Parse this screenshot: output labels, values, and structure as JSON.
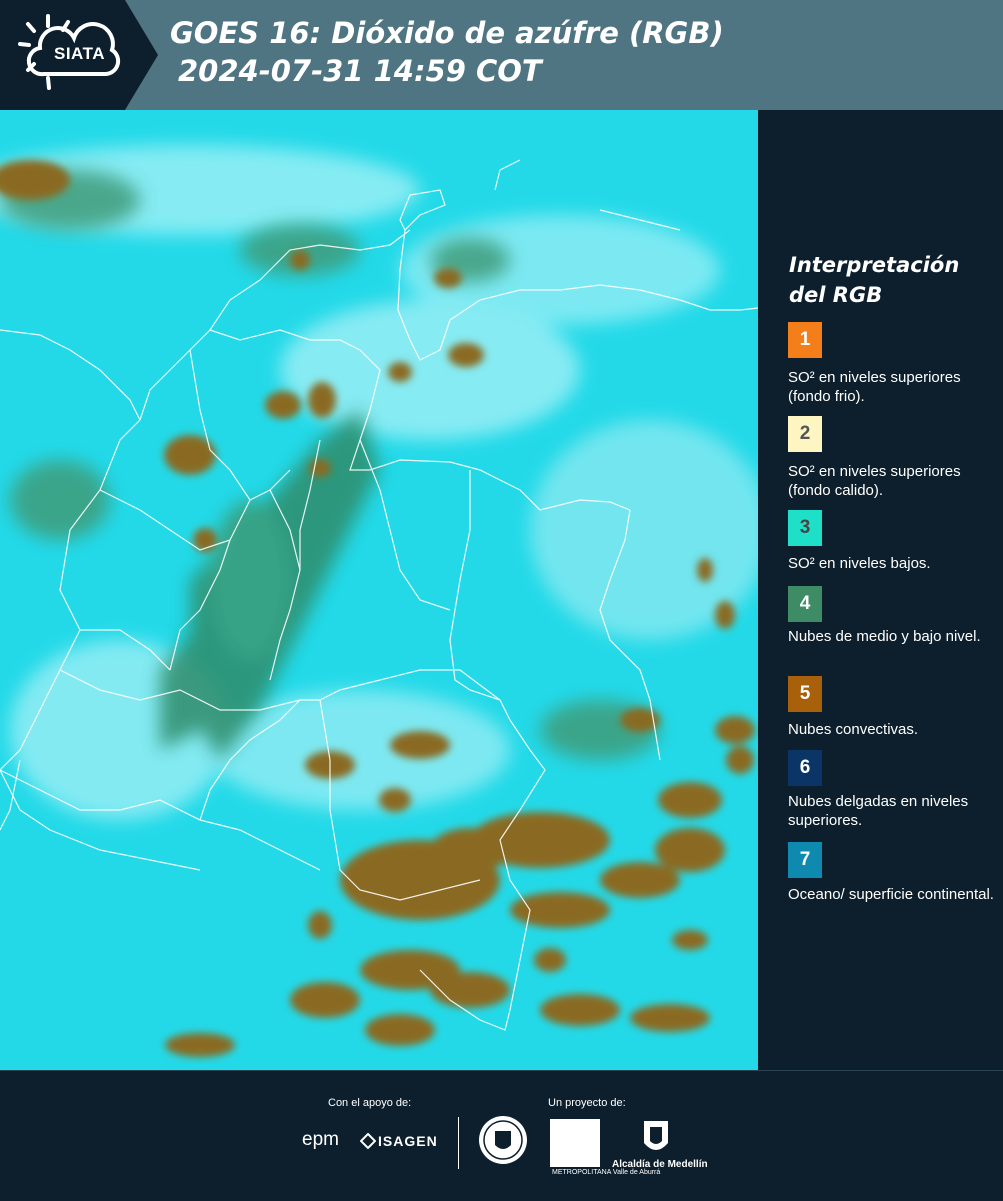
{
  "header": {
    "logo_text": "SIATA",
    "title_line1": "GOES 16: Dióxido de azúfre (RGB)",
    "title_line2": "2024-07-31 14:59 COT"
  },
  "legend": {
    "title": "Interpretación del RGB",
    "items": [
      {
        "number": "1",
        "color": "#f47f1a",
        "number_color": "#ffffff",
        "description": "SO² en niveles superiores (fondo frio)."
      },
      {
        "number": "2",
        "color": "#fdf5c2",
        "number_color": "#555555",
        "description": "SO² en niveles superiores (fondo calido)."
      },
      {
        "number": "3",
        "color": "#1ee0c8",
        "number_color": "#444444",
        "description": "SO² en niveles bajos."
      },
      {
        "number": "4",
        "color": "#3d8c66",
        "number_color": "#ffffff",
        "description": "Nubes de medio y bajo nivel."
      },
      {
        "number": "5",
        "color": "#a8610a",
        "number_color": "#ffffff",
        "description": "Nubes convectivas."
      },
      {
        "number": "6",
        "color": "#0b3566",
        "number_color": "#ffffff",
        "description": "Nubes delgadas en niveles superiores."
      },
      {
        "number": "7",
        "color": "#0e8ab0",
        "number_color": "#ffffff",
        "description": "Oceano/ superficie continental."
      }
    ]
  },
  "footer": {
    "support_label": "Con el apoyo de:",
    "project_label": "Un proyecto de:",
    "sponsor_epm": "epm",
    "sponsor_isagen": "ISAGEN",
    "area_text": "METROPOLITANA Valle de Aburrá",
    "alcaldia_text": "Alcaldía de Medellín"
  },
  "colors": {
    "header_bg": "#4f7482",
    "panel_bg": "#0d1f2d",
    "map_base": "#23d9e8",
    "land_green": "#2f8c6a",
    "convective": "#8a6a22"
  }
}
